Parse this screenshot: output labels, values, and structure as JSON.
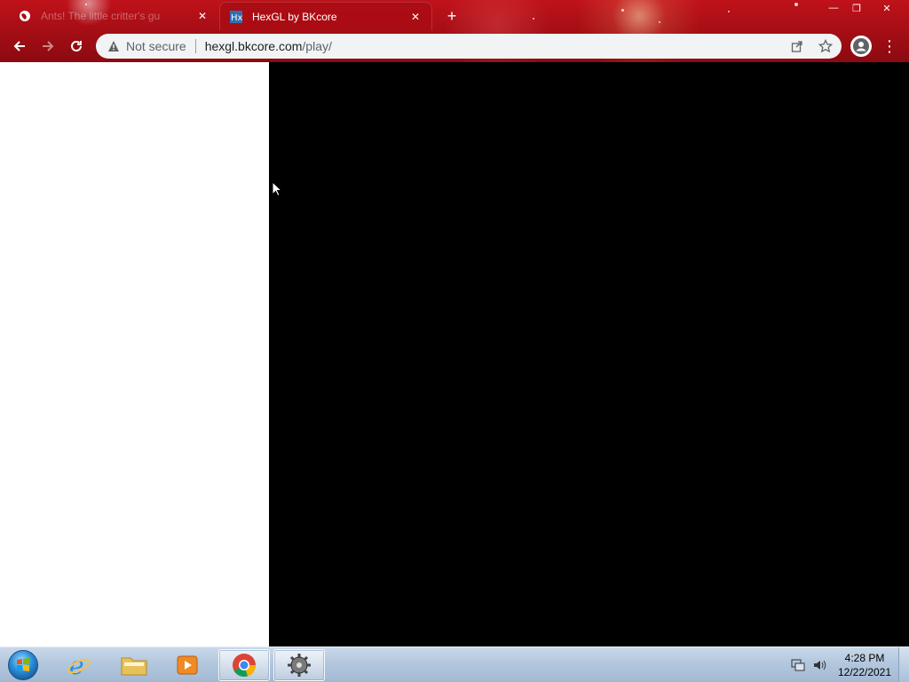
{
  "browser": {
    "tabs": [
      {
        "title": "Ants! The little critter's gu",
        "favicon": "globe-icon",
        "active": false
      },
      {
        "title": "HexGL by BKcore",
        "favicon": "hexgl-icon",
        "active": true
      }
    ],
    "new_tab_label": "+",
    "window_controls": {
      "minimize": "—",
      "restore": "❐",
      "close": "✕"
    },
    "omnibox": {
      "security_label": "Not secure",
      "url_host": "hexgl.bkcore.com",
      "url_path": "/play/"
    },
    "accent_color": "#b3101a"
  },
  "page": {
    "left_panel_color": "#ffffff",
    "canvas_color": "#000000"
  },
  "taskbar": {
    "pinned": [
      {
        "name": "internet-explorer",
        "icon": "ie-icon"
      },
      {
        "name": "file-explorer",
        "icon": "folder-icon"
      },
      {
        "name": "media-player",
        "icon": "media-player-icon"
      },
      {
        "name": "chrome",
        "icon": "chrome-icon",
        "active": true
      },
      {
        "name": "hexgl-app",
        "icon": "gear-icon"
      }
    ],
    "clock": {
      "time": "4:28 PM",
      "date": "12/22/2021"
    }
  }
}
